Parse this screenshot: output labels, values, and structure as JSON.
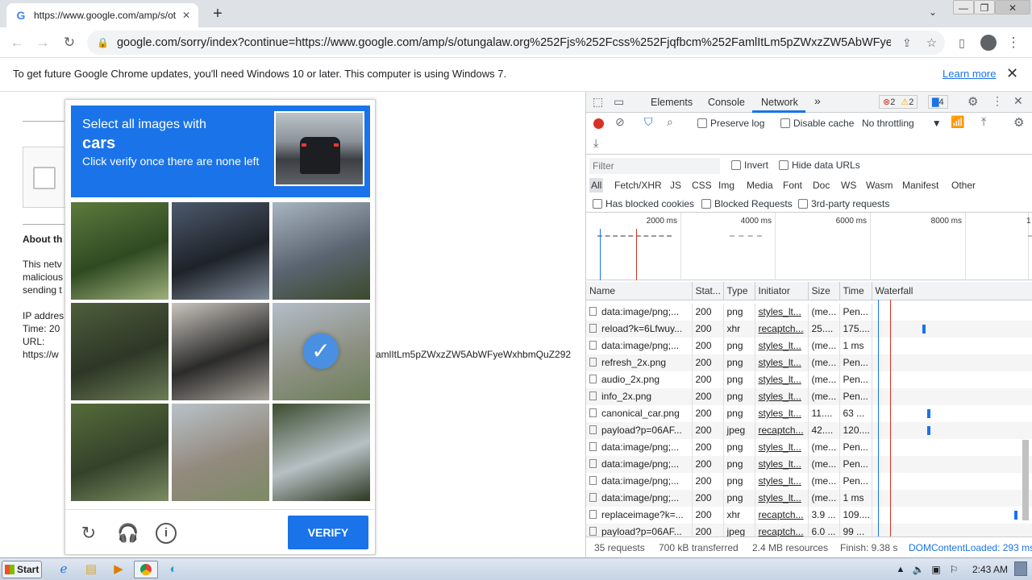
{
  "browser": {
    "tab_title": "https://www.google.com/amp/s/otu",
    "url": "google.com/sorry/index?continue=https://www.google.com/amp/s/otungalaw.org%252Fjs%252Fcss%252Fjqfbcm%252FamlItLm5pZWxzZW5AbWFye...",
    "new_tab": "+",
    "win_min": "—",
    "win_max": "❐",
    "win_close": "✕"
  },
  "infobar": {
    "message": "To get future Google Chrome updates, you'll need Windows 10 or later. This computer is using Windows 7.",
    "link": "Learn more",
    "close": "✕"
  },
  "page": {
    "about": "About th",
    "line1": "This netv",
    "line2": "malicious",
    "line3": "sending t",
    "ip": "IP addres",
    "time": "Time: 20",
    "url_label": "URL:",
    "url_value": "https://w",
    "url_tail": "amlItLm5pZWxzZW5AbWFyeWxhbmQuZ292"
  },
  "captcha": {
    "line1": "Select all images with",
    "keyword": "cars",
    "line3": "Click verify once there are none left",
    "verify": "VERIFY",
    "checkmark": "✓",
    "tiles": [
      {
        "colors": [
          "#5d7a3e",
          "#2f4a21",
          "#9fb07c"
        ],
        "selected": false
      },
      {
        "colors": [
          "#4d5a6c",
          "#1e2229",
          "#7f8b99"
        ],
        "selected": false
      },
      {
        "colors": [
          "#a9b5c0",
          "#5a6470",
          "#3b4a2c"
        ],
        "selected": false
      },
      {
        "colors": [
          "#4d5e3c",
          "#2e3626",
          "#6a7d55"
        ],
        "selected": false
      },
      {
        "colors": [
          "#c9c5bd",
          "#2b2b2b",
          "#a8a29a"
        ],
        "selected": false
      },
      {
        "colors": [
          "#b2bec9",
          "#8e9083",
          "#6b7f58"
        ],
        "selected": true
      },
      {
        "colors": [
          "#556b3a",
          "#34422a",
          "#7b8c63"
        ],
        "selected": false
      },
      {
        "colors": [
          "#b9c2c9",
          "#928a7e",
          "#7d8a66"
        ],
        "selected": false
      },
      {
        "colors": [
          "#3c4d30",
          "#b7c0c4",
          "#2c3822"
        ],
        "selected": false
      }
    ]
  },
  "devtools": {
    "tabs": [
      "Elements",
      "Console",
      "Network"
    ],
    "active_tab": "Network",
    "more": "»",
    "errors": "2",
    "warnings": "2",
    "messages": "4",
    "preserve_log": "Preserve log",
    "disable_cache": "Disable cache",
    "throttling": "No throttling",
    "filter_placeholder": "Filter",
    "invert": "Invert",
    "hide_data_urls": "Hide data URLs",
    "filter_types": [
      "All",
      "Fetch/XHR",
      "JS",
      "CSS",
      "Img",
      "Media",
      "Font",
      "Doc",
      "WS",
      "Wasm",
      "Manifest",
      "Other"
    ],
    "has_blocked_cookies": "Has blocked cookies",
    "blocked_requests": "Blocked Requests",
    "third_party": "3rd-party requests",
    "timeline_ticks": [
      "2000 ms",
      "4000 ms",
      "6000 ms",
      "8000 ms",
      "1"
    ],
    "columns": [
      "Name",
      "Stat...",
      "Type",
      "Initiator",
      "Size",
      "Time",
      "Waterfall"
    ],
    "rows": [
      {
        "name": "data:image/png;...",
        "status": "200",
        "type": "png",
        "initiator": "styles_lt...",
        "size": "(me...",
        "time": "Pen..."
      },
      {
        "name": "reload?k=6Lfwuy...",
        "status": "200",
        "type": "xhr",
        "initiator": "recaptch...",
        "size": "25....",
        "time": "175...."
      },
      {
        "name": "data:image/png;...",
        "status": "200",
        "type": "png",
        "initiator": "styles_lt...",
        "size": "(me...",
        "time": "1 ms"
      },
      {
        "name": "refresh_2x.png",
        "status": "200",
        "type": "png",
        "initiator": "styles_lt...",
        "size": "(me...",
        "time": "Pen..."
      },
      {
        "name": "audio_2x.png",
        "status": "200",
        "type": "png",
        "initiator": "styles_lt...",
        "size": "(me...",
        "time": "Pen..."
      },
      {
        "name": "info_2x.png",
        "status": "200",
        "type": "png",
        "initiator": "styles_lt...",
        "size": "(me...",
        "time": "Pen..."
      },
      {
        "name": "canonical_car.png",
        "status": "200",
        "type": "png",
        "initiator": "styles_lt...",
        "size": "11....",
        "time": "63 ..."
      },
      {
        "name": "payload?p=06AF...",
        "status": "200",
        "type": "jpeg",
        "initiator": "recaptch...",
        "size": "42....",
        "time": "120...."
      },
      {
        "name": "data:image/png;...",
        "status": "200",
        "type": "png",
        "initiator": "styles_lt...",
        "size": "(me...",
        "time": "Pen..."
      },
      {
        "name": "data:image/png;...",
        "status": "200",
        "type": "png",
        "initiator": "styles_lt...",
        "size": "(me...",
        "time": "Pen..."
      },
      {
        "name": "data:image/png;...",
        "status": "200",
        "type": "png",
        "initiator": "styles_lt...",
        "size": "(me...",
        "time": "Pen..."
      },
      {
        "name": "data:image/png;...",
        "status": "200",
        "type": "png",
        "initiator": "styles_lt...",
        "size": "(me...",
        "time": "1 ms"
      },
      {
        "name": "replaceimage?k=...",
        "status": "200",
        "type": "xhr",
        "initiator": "recaptch...",
        "size": "3.9 ...",
        "time": "109...."
      },
      {
        "name": "payload?p=06AF...",
        "status": "200",
        "type": "jpeg",
        "initiator": "recaptch...",
        "size": "6.0 ...",
        "time": "99 ..."
      }
    ],
    "status": {
      "requests": "35 requests",
      "transferred": "700 kB transferred",
      "resources": "2.4 MB resources",
      "finish": "Finish: 9.38 s",
      "dcl": "DOMContentLoaded: 293 ms"
    }
  },
  "taskbar": {
    "start": "Start",
    "time": "2:43 AM"
  },
  "colors": {
    "captcha_blue": "#1a73e8",
    "record_red": "#d93025"
  }
}
